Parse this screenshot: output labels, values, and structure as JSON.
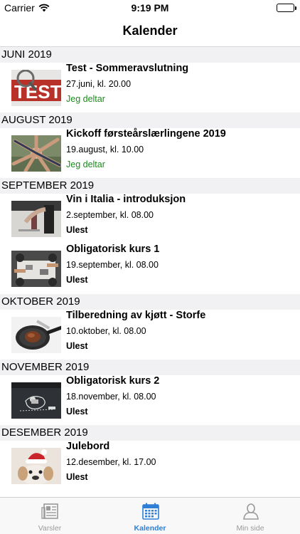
{
  "status_bar": {
    "carrier": "Carrier",
    "time": "9:19 PM"
  },
  "nav": {
    "title": "Kalender"
  },
  "sections": [
    {
      "header": "JUNI 2019",
      "events": [
        {
          "title": "Test - Sommeravslutning",
          "date": "27.juni, kl. 20.00",
          "status": "Jeg deltar",
          "image": "test-sign-image"
        }
      ]
    },
    {
      "header": "AUGUST 2019",
      "events": [
        {
          "title": "Kickoff førsteårslærlingene 2019",
          "date": "19.august, kl. 10.00",
          "status": "Jeg deltar",
          "image": "team-hands-image"
        }
      ]
    },
    {
      "header": "SEPTEMBER 2019",
      "events": [
        {
          "title": "Vin i Italia - introduksjon",
          "date": "2.september, kl. 08.00",
          "status": "Ulest",
          "image": "wine-pouring-image"
        },
        {
          "title": "Obligatorisk kurs 1",
          "date": "19.september, kl. 08.00",
          "status": "Ulest",
          "image": "meeting-table-image"
        }
      ]
    },
    {
      "header": "OKTOBER 2019",
      "events": [
        {
          "title": "Tilberedning av kjøtt - Storfe",
          "date": "10.oktober, kl. 08.00",
          "status": "Ulest",
          "image": "steak-pan-image"
        }
      ]
    },
    {
      "header": "NOVEMBER 2019",
      "events": [
        {
          "title": "Obligatorisk kurs 2",
          "date": "18.november, kl. 08.00",
          "status": "Ulest",
          "image": "chalkboard-image"
        }
      ]
    },
    {
      "header": "DESEMBER 2019",
      "events": [
        {
          "title": "Julebord",
          "date": "12.desember, kl. 17.00",
          "status": "Ulest",
          "image": "santa-dog-image"
        }
      ]
    }
  ],
  "tabs": [
    {
      "label": "Varsler",
      "icon": "newspaper-icon",
      "active": false
    },
    {
      "label": "Kalender",
      "icon": "calendar-icon",
      "active": true
    },
    {
      "label": "Min side",
      "icon": "person-icon",
      "active": false
    }
  ],
  "colors": {
    "attending": "#1e8a1e",
    "accent": "#2f7fd6",
    "section_bg": "#f1f1f3",
    "inactive_tab": "#9a9a9a"
  }
}
